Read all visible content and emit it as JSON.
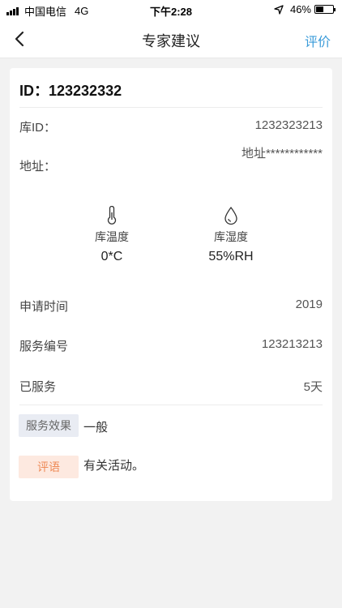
{
  "status": {
    "carrier": "中国电信",
    "network": "4G",
    "time": "下午2:28",
    "battery": "46%",
    "battery_level": 0.46
  },
  "nav": {
    "title": "专家建议",
    "action": "评价"
  },
  "card": {
    "id_text": "ID：123232332",
    "fields": {
      "warehouse_id_label": "库ID：",
      "warehouse_id_value": "1232323213",
      "address_label": "地址：",
      "address_value": "地址************"
    },
    "env": {
      "temperature_label": "库温度",
      "temperature_value": "0*C",
      "humidity_label": "库湿度",
      "humidity_value": "55%RH"
    },
    "info": {
      "apply_time_label": "申请时间",
      "apply_time_value": "2019",
      "service_no_label": "服务编号",
      "service_no_value": "123213213",
      "served_label": "已服务",
      "served_value": "5天"
    },
    "review": {
      "effect_tag": "服务效果",
      "effect_value": "一般",
      "comment_tag": "评语",
      "comment_value": "有关活动。"
    }
  },
  "icons": {
    "back": "chevron-left-icon",
    "location": "location-arrow-icon",
    "temperature": "thermometer-icon",
    "humidity": "droplet-icon"
  }
}
